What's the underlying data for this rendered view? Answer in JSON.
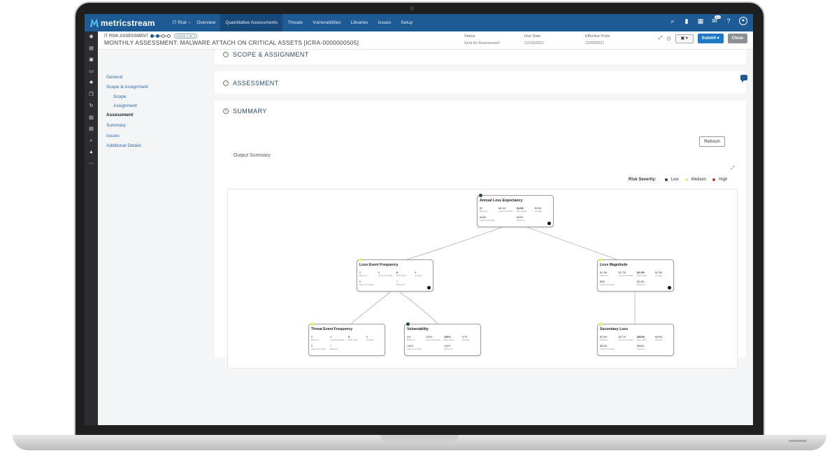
{
  "app": {
    "brand": "metricstream",
    "nav": [
      "IT-Risk",
      "Overview",
      "Quantitative Assessments",
      "Threats",
      "Vulnerabilities",
      "Libraries",
      "Issues",
      "Setup"
    ],
    "active_nav": "Quantitative Assessments",
    "notification_badge": "10+"
  },
  "header": {
    "breadcrumb": "IT RISK ASSESSMENT",
    "stage_chip": "STAGE 2 OF 4",
    "title": "MONTHLY ASSESSMENT: MALWARE ATTACH ON CRITICAL ASSETS [ICRA-0000000505]",
    "status_label": "Status",
    "status_value": "Sent for Assessment",
    "due_label": "Due Date",
    "due_value": "12/18/2021",
    "effective_label": "Effective From",
    "effective_value": "12/09/2021",
    "submit_label": "Submit",
    "close_label": "Close"
  },
  "leftnav": {
    "general": "General",
    "scope_assignment": "Scope & Assignment",
    "scope": "Scope",
    "assignment": "Assignment",
    "assessment": "Assessment",
    "summary": "Summary",
    "issues": "Issues",
    "additional": "Additional Details"
  },
  "sections": {
    "scope": "SCOPE & ASSIGNMENT",
    "assessment": "ASSESSMENT",
    "summary": "SUMMARY",
    "refresh": "Refresh",
    "output_summary": "Output Summary"
  },
  "legend": {
    "label": "Risk Severity:",
    "low": "Low",
    "medium": "Medium",
    "high": "High",
    "colors": {
      "low": "#2e4a44",
      "medium": "#e8ee7a",
      "high": "#c0392b"
    }
  },
  "nodes": {
    "ale": {
      "title": "Annual Loss Expectancy",
      "v1": "$0",
      "s1": "Minimum",
      "v2": "$8.1M",
      "s2": "Lower Percentile",
      "v3": "$12M",
      "s3": "Most Likely",
      "v4": "$12M",
      "s4": "Average",
      "v5": "$16M",
      "s5": "Upper Percentile",
      "v6": "$20M",
      "s6": "Maximum"
    },
    "lef": {
      "title": "Loss Event Frequency",
      "v1": "0",
      "s1": "Minimum",
      "v2": "4",
      "s2": "Lower Percentile",
      "v3": "5",
      "s3": "Most Likely",
      "v4": "5",
      "s4": "Average",
      "v5": "6",
      "s5": "Upper Percentile",
      "v6": "7",
      "s6": "Maximum"
    },
    "lm": {
      "title": "Loss Magnitude",
      "v1": "$1.3M",
      "s1": "Minimum",
      "v2": "$1.7M",
      "s2": "Lower Percentile",
      "v3": "$2.3M",
      "s3": "Most Likely",
      "v4": "$2.3M",
      "s4": "Average",
      "v5": "$3M",
      "s5": "Upper Percentile",
      "v6": "$3.4M",
      "s6": "Maximum"
    },
    "tef": {
      "title": "Threat Event Frequency",
      "v1": "0",
      "s1": "Minimum",
      "v2": "4",
      "s2": "Lower Percentile",
      "v3": "5",
      "s3": "Most Likely",
      "v4": "5",
      "s4": "Average",
      "v5": "6",
      "s5": "Upper Percentile",
      "v6": "7",
      "s6": "Maximum"
    },
    "vul": {
      "title": "Vulnerability",
      "v1": "0%",
      "s1": "Minimum",
      "v2": "100%",
      "s2": "Lower Percentile",
      "v3": "100%",
      "s3": "Most Likely",
      "v4": "97%",
      "s4": "Average",
      "v5": "100%",
      "s5": "Upper Percentile",
      "v6": "100%",
      "s6": "Maximum"
    },
    "sl": {
      "title": "Secondary Loss",
      "v1": "$219K",
      "s1": "Minimum",
      "v2": "$271K",
      "s2": "Lower Percentile",
      "v3": "$403K",
      "s3": "Most Likely",
      "v4": "$403K",
      "s4": "Average",
      "v5": "$523K",
      "s5": "Upper Percentile",
      "v6": "$563K",
      "s6": "Maximum"
    }
  }
}
